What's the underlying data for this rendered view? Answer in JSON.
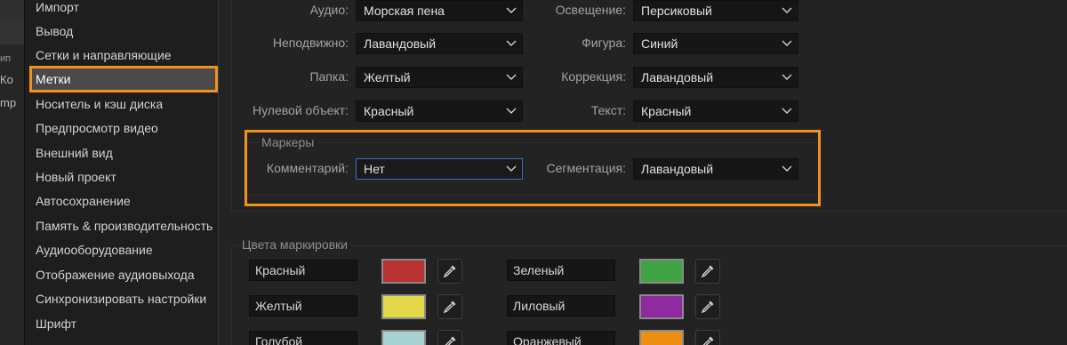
{
  "edge": {
    "text1": "ип",
    "text2": "Ко",
    "text3": "mp"
  },
  "sidebar": {
    "items": [
      {
        "label": "Импорт"
      },
      {
        "label": "Вывод"
      },
      {
        "label": "Сетки и направляющие"
      },
      {
        "label": "Метки",
        "selected": true
      },
      {
        "label": "Носитель и кэш диска"
      },
      {
        "label": "Предпросмотр видео"
      },
      {
        "label": "Внешний вид"
      },
      {
        "label": "Новый проект"
      },
      {
        "label": "Автосохранение"
      },
      {
        "label": "Память & производительность"
      },
      {
        "label": "Аудиооборудование"
      },
      {
        "label": "Отображение аудиовыхода"
      },
      {
        "label": "Синхронизировать настройки"
      },
      {
        "label": "Шрифт"
      }
    ]
  },
  "label_defaults": {
    "audio": {
      "label": "Аудио:",
      "value": "Морская пена"
    },
    "still": {
      "label": "Неподвижно:",
      "value": "Лавандовый"
    },
    "folder": {
      "label": "Папка:",
      "value": "Желтый"
    },
    "null_object": {
      "label": "Нулевой объект:",
      "value": "Красный"
    },
    "lighting": {
      "label": "Освещение:",
      "value": "Персиковый"
    },
    "shape": {
      "label": "Фигура:",
      "value": "Синий"
    },
    "correction": {
      "label": "Коррекция:",
      "value": "Лавандовый"
    },
    "text": {
      "label": "Текст:",
      "value": "Красный"
    }
  },
  "markers": {
    "title": "Маркеры",
    "comment": {
      "label": "Комментарий:",
      "value": "Нет"
    },
    "segmentation": {
      "label": "Сегментация:",
      "value": "Лавандовый"
    }
  },
  "label_colors": {
    "title": "Цвета маркировки",
    "items": [
      {
        "name": "Красный",
        "color": "#b83232"
      },
      {
        "name": "Зеленый",
        "color": "#3ea443"
      },
      {
        "name": "Желтый",
        "color": "#e3d84a"
      },
      {
        "name": "Лиловый",
        "color": "#8f2aa0"
      },
      {
        "name": "Голубой",
        "color": "#a9d2d2"
      },
      {
        "name": "Оранжевый",
        "color": "#ee8e12"
      }
    ]
  },
  "icons": {
    "dropdown": "chevron-down-icon",
    "eyedropper": "eyedropper-icon"
  },
  "accent_color": "#f0921c"
}
